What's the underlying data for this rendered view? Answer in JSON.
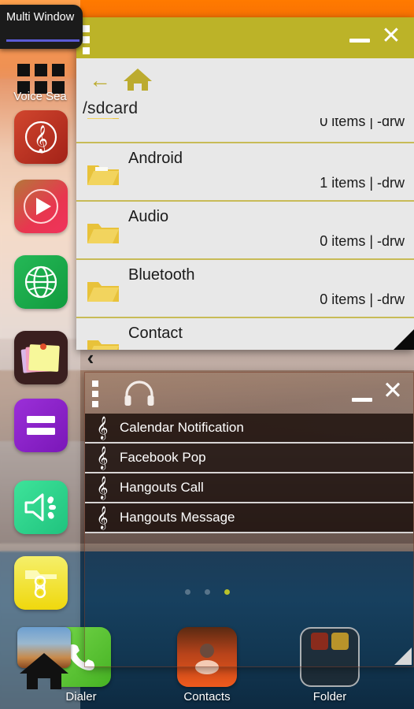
{
  "multi_window": {
    "tab_label": "Multi Window"
  },
  "sidebar": {
    "apps_grid_icon": "apps-grid-icon",
    "voice_search_label": "Voice Sea",
    "collapse_handle": "‹",
    "items": [
      {
        "name": "music-app",
        "icon": "treble-clef-icon",
        "color": "#c0392b"
      },
      {
        "name": "video-player-app",
        "icon": "play-circle-icon",
        "color": "#e8364f"
      },
      {
        "name": "browser-app",
        "icon": "globe-icon",
        "color": "#1faa4e"
      },
      {
        "name": "notes-app",
        "icon": "sticky-notes-icon",
        "color": "#3a1f1f"
      },
      {
        "name": "calculator-app",
        "icon": "equals-icon",
        "color": "#8b1fc4"
      },
      {
        "name": "sound-app",
        "icon": "speaker-icon",
        "color": "#2fd08a"
      },
      {
        "name": "file-manager-app",
        "icon": "folder-gear-icon",
        "color": "#f2e12a"
      }
    ]
  },
  "file_window": {
    "title_bar_color": "#bcb328",
    "menu_icon": "three-dots-icon",
    "minimize_icon": "minimize-icon",
    "close_icon": "close-icon",
    "back_icon": "back-arrow-icon",
    "home_icon": "home-icon",
    "path": "/sdcard",
    "resize_handle": "resize-corner-icon",
    "rows": [
      {
        "name": "",
        "meta": "0 items | -drw",
        "partial": true
      },
      {
        "name": "Android",
        "meta": "1 items | -drw"
      },
      {
        "name": "Audio",
        "meta": "0 items | -drw"
      },
      {
        "name": "Bluetooth",
        "meta": "0 items | -drw"
      },
      {
        "name": "Contact",
        "meta": ""
      }
    ]
  },
  "music_window": {
    "menu_icon": "three-dots-icon",
    "app_icon": "headphones-icon",
    "minimize_icon": "minimize-icon",
    "close_icon": "close-icon",
    "resize_handle": "resize-corner-icon",
    "items": [
      {
        "label": "Calendar Notification",
        "icon": "treble-clef-icon"
      },
      {
        "label": "Facebook Pop",
        "icon": "treble-clef-icon"
      },
      {
        "label": "Hangouts Call",
        "icon": "treble-clef-icon"
      },
      {
        "label": "Hangouts Message",
        "icon": "treble-clef-icon"
      }
    ]
  },
  "page_indicator": {
    "count": 3,
    "active": 3
  },
  "dock": {
    "items": [
      {
        "label": "Dialer",
        "icon": "phone-icon",
        "color": "#5bc236"
      },
      {
        "label": "Contacts",
        "icon": "person-icon",
        "color": "#e8551f"
      },
      {
        "label": "Folder",
        "icon": "folder-icon",
        "color": "#2b2b2b"
      }
    ],
    "home_icon": "home-icon"
  }
}
